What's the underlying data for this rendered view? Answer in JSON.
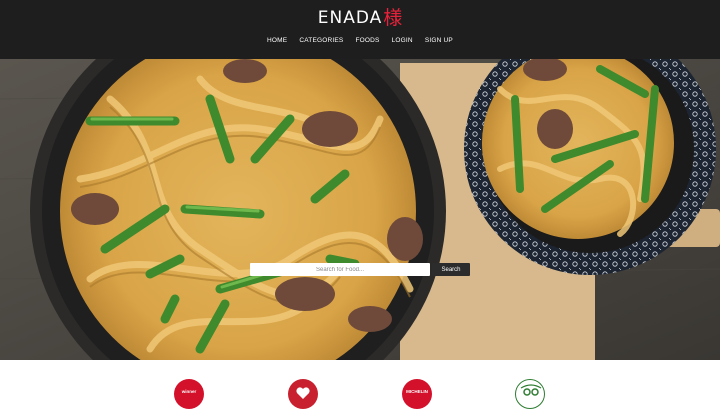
{
  "brand": {
    "logo_text": "ENADA",
    "logo_mark": "様",
    "logo_mark_color": "#e8223a"
  },
  "nav": {
    "items": [
      {
        "label": "HOME"
      },
      {
        "label": "CATEGORIES"
      },
      {
        "label": "FOODS"
      },
      {
        "label": "LOGIN"
      },
      {
        "label": "SIGN UP"
      }
    ]
  },
  "search": {
    "placeholder": "Search for Food...",
    "value": "",
    "button_label": "Search"
  },
  "awards": [
    {
      "icon": "winner-badge-icon",
      "label": "winner",
      "color": "#d3112b"
    },
    {
      "icon": "peoples-choice-badge-icon",
      "label": "",
      "color": "#c8202f"
    },
    {
      "icon": "michelin-guide-badge-icon",
      "label": "MICHELIN",
      "color": "#d3112b"
    },
    {
      "icon": "travellers-choice-badge-icon",
      "label": "",
      "color": "#2e7d32"
    }
  ],
  "colors": {
    "header_bg": "#1f1e1f",
    "accent": "#e8223a"
  }
}
